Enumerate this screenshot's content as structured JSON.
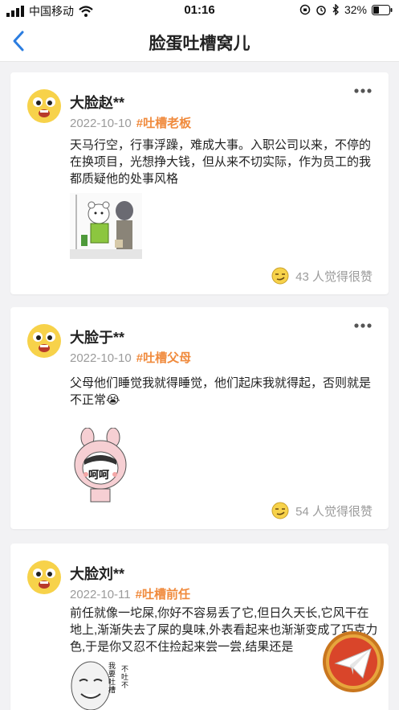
{
  "status_bar": {
    "carrier": "中国移动",
    "time": "01:16",
    "battery": "32%"
  },
  "nav": {
    "title": "脸蛋吐槽窝儿"
  },
  "posts": [
    {
      "name": "大脸赵**",
      "date": "2022-10-10",
      "tag": "#吐槽老板",
      "text": "天马行空，行事浮躁，难成大事。入职公司以来，不停的在换项目，光想挣大钱，但从来不切实际，作为员工的我都质疑他的处事风格",
      "likes": "43 人觉得很赞"
    },
    {
      "name": "大脸于**",
      "date": "2022-10-10",
      "tag": "#吐槽父母",
      "text": "父母他们睡觉我就得睡觉，他们起床我就得起，否则就是不正常😭",
      "sticker_text": "呵呵",
      "likes": "54 人觉得很赞"
    },
    {
      "name": "大脸刘**",
      "date": "2022-10-11",
      "tag": "#吐槽前任",
      "text": "前任就像一坨屎,你好不容易丢了它,但日久天长,它风干在地上,渐渐失去了屎的臭味,外表看起来也渐渐变成了巧克力色,于是你又忍不住捡起来尝一尝,结果还是",
      "sticker_text_1": "我要吐槽",
      "sticker_text_2": "不吐不"
    }
  ],
  "colors": {
    "accent_tag": "#f08a3c",
    "back_arrow": "#2b7de0",
    "fab_ring": "#c9761e",
    "fab_fill": "#d9452a"
  }
}
